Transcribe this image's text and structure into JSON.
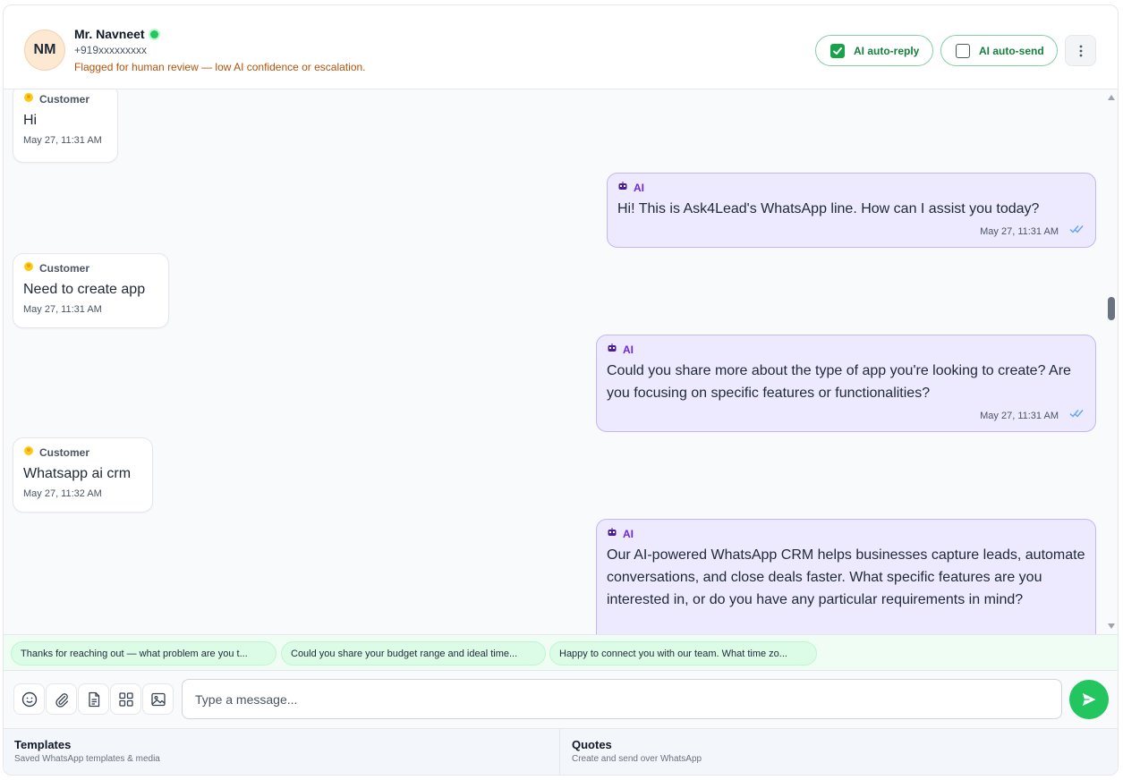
{
  "header": {
    "avatar_initials": "NM",
    "contact_name": "Mr. Navneet",
    "phone": "+919xxxxxxxxx",
    "flag_text": "Flagged for human review — low AI confidence or escalation.",
    "ai_auto_reply_label": "AI auto-reply",
    "ai_auto_reply_checked": true,
    "ai_auto_send_label": "AI auto-send",
    "ai_auto_send_checked": false
  },
  "messages": [
    {
      "sender": "Customer",
      "icon": "customer-icon",
      "text": "Hi",
      "time": "May 27, 11:31 AM"
    },
    {
      "sender": "AI",
      "icon": "robot-icon",
      "text": "Hi! This is Ask4Lead's WhatsApp line. How can I assist you today?",
      "time": "May 27, 11:31 AM",
      "status": "read"
    },
    {
      "sender": "Customer",
      "icon": "customer-icon",
      "text": "Need to create app",
      "time": "May 27, 11:31 AM"
    },
    {
      "sender": "AI",
      "icon": "robot-icon",
      "text": "Could you share more about the type of app you're looking to create? Are you focusing on specific features or functionalities?",
      "time": "May 27, 11:31 AM",
      "status": "read"
    },
    {
      "sender": "Customer",
      "icon": "customer-icon",
      "text": "Whatsapp ai crm",
      "time": "May 27, 11:32 AM"
    },
    {
      "sender": "AI",
      "icon": "robot-icon",
      "text": "Our AI-powered WhatsApp CRM helps businesses capture leads, automate conversations, and close deals faster. What specific features are you interested in, or do you have any particular requirements in mind?"
    }
  ],
  "suggestions": [
    "Thanks for reaching out — what problem are you t...",
    "Could you share your budget range and ideal time...",
    "Happy to connect you with our team. What time zo..."
  ],
  "composer": {
    "placeholder": "Type a message...",
    "tools": [
      "emoji-icon",
      "paperclip-icon",
      "document-icon",
      "grid-icon",
      "image-icon"
    ]
  },
  "footer": {
    "templates_title": "Templates",
    "templates_sub": "Saved WhatsApp templates & media",
    "quotes_title": "Quotes",
    "quotes_sub": "Create and send over WhatsApp"
  },
  "colors": {
    "accent_green": "#22c55e",
    "ai_bubble": "#ede9fe",
    "ai_label": "#6d28d9",
    "flag_text": "#b45309"
  }
}
